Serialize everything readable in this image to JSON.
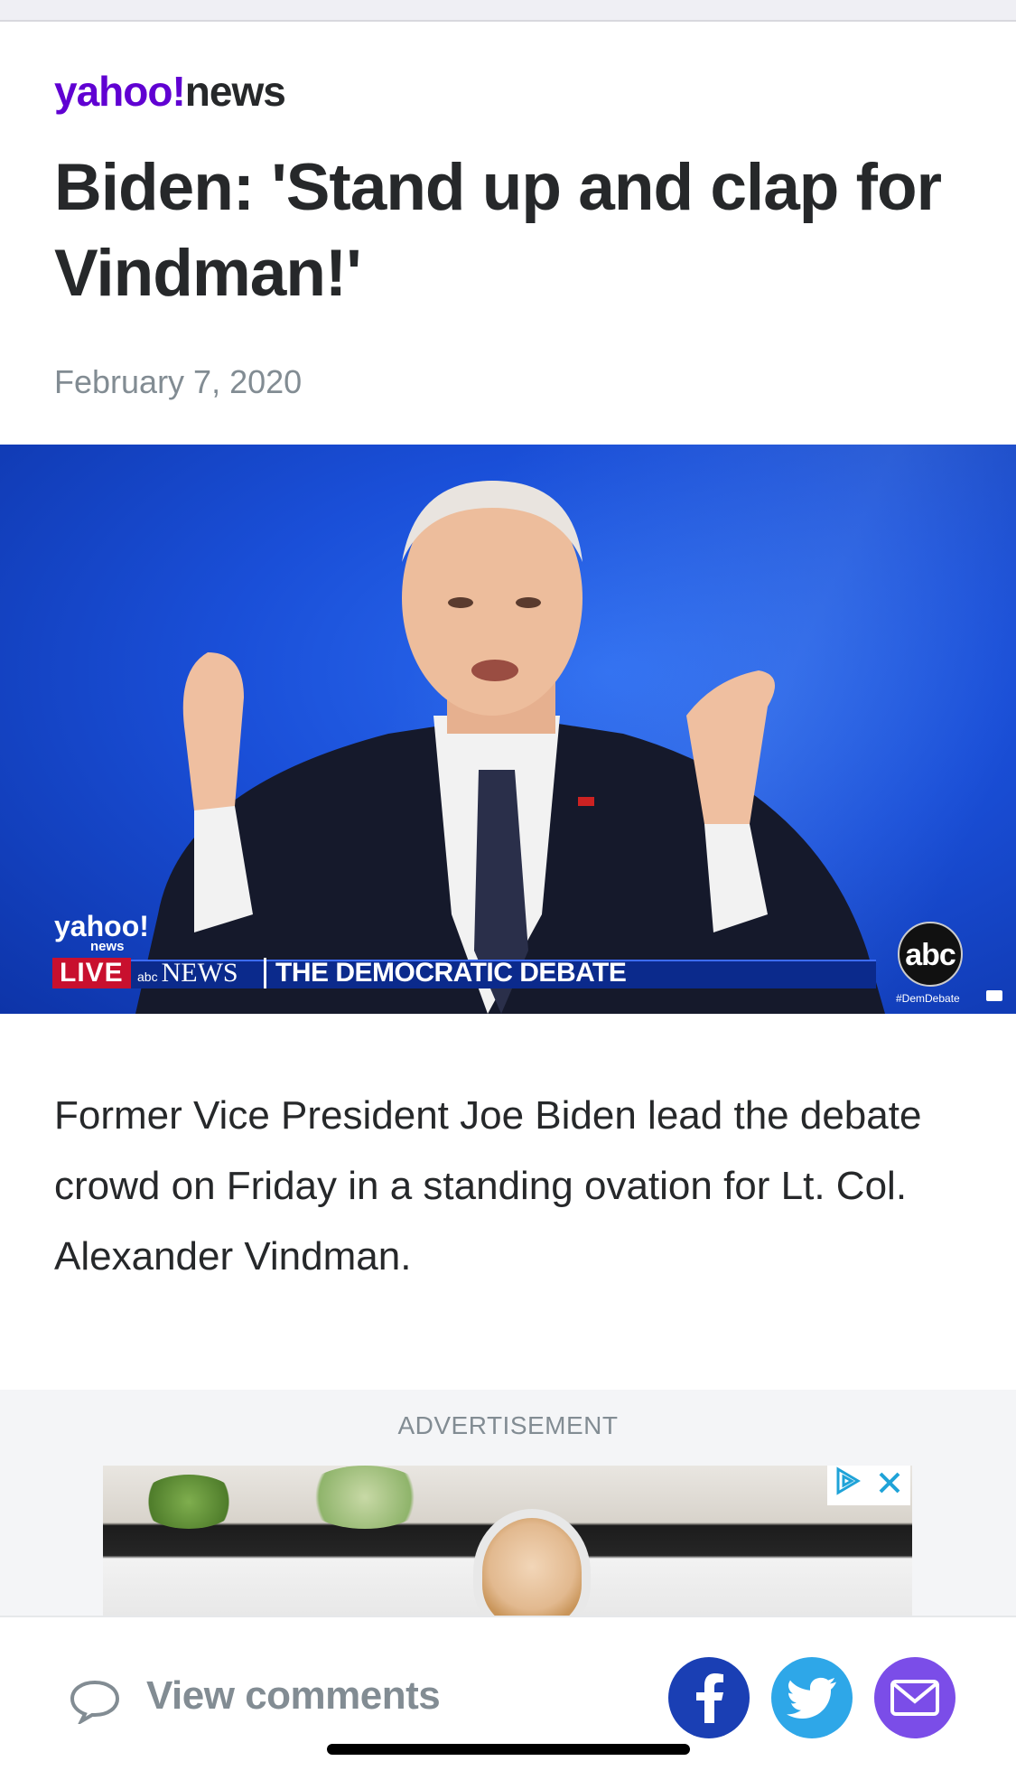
{
  "brand": {
    "logo_text_yahoo": "yahoo!",
    "logo_text_news": "news",
    "accent_color": "#6001d2"
  },
  "article": {
    "headline": "Biden: 'Stand up and clap for Vindman!'",
    "date": "February 7, 2020",
    "body": "Former Vice President Joe Biden lead the debate crowd on Friday in a standing ovation for Lt. Col. Alexander Vindman."
  },
  "hero": {
    "yahoo_bug": "yahoo!",
    "yahoo_bug_sub": "news",
    "live_label": "LIVE",
    "network_small": "abc",
    "network_label": "NEWS",
    "program_title": "THE DEMOCRATIC DEBATE",
    "abc_logo": "abc",
    "hashtag": "#DemDebate"
  },
  "advertisement": {
    "label": "ADVERTISEMENT",
    "choices_icon": "ad-choices-icon",
    "close_icon": "close-icon"
  },
  "bottom_bar": {
    "comments_label": "View comments",
    "comment_icon": "speech-bubble-icon",
    "share": [
      {
        "name": "facebook",
        "icon": "facebook-icon",
        "color": "#1a3fb4"
      },
      {
        "name": "twitter",
        "icon": "twitter-icon",
        "color": "#2ea7e8"
      },
      {
        "name": "email",
        "icon": "mail-icon",
        "color": "#7b4de8"
      }
    ]
  }
}
